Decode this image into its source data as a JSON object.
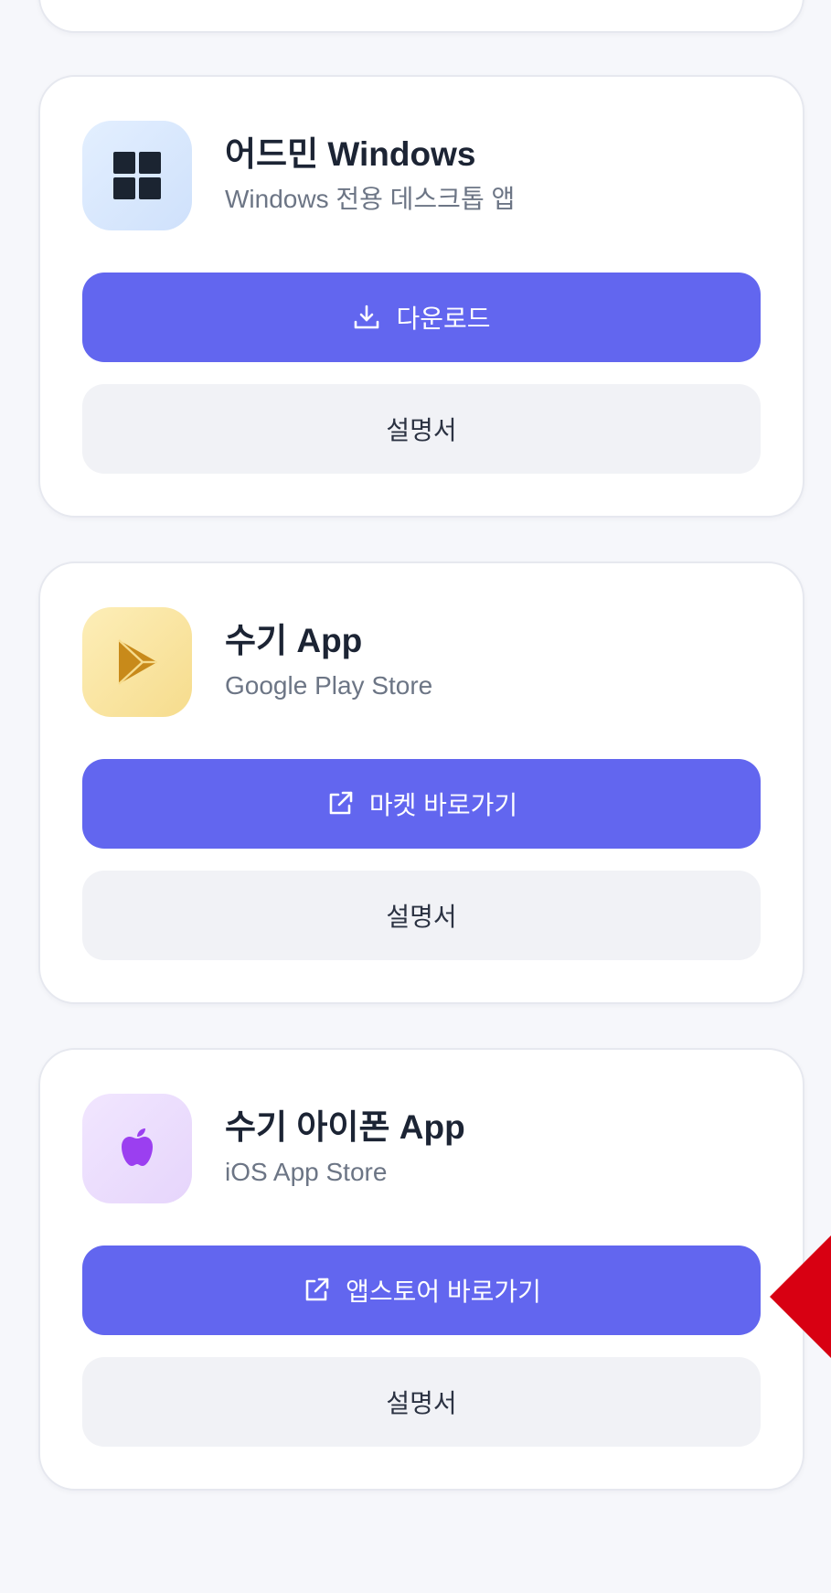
{
  "cards": [
    {
      "title": "어드민 Windows",
      "subtitle": "Windows 전용 데스크톱 앱",
      "icon": "windows-icon",
      "primary_label": "다운로드",
      "primary_icon": "download-icon",
      "secondary_label": "설명서"
    },
    {
      "title": "수기 App",
      "subtitle": "Google Play Store",
      "icon": "play-store-icon",
      "primary_label": "마켓 바로가기",
      "primary_icon": "external-link-icon",
      "secondary_label": "설명서"
    },
    {
      "title": "수기 아이폰 App",
      "subtitle": "iOS App Store",
      "icon": "apple-icon",
      "primary_label": "앱스토어 바로가기",
      "primary_icon": "external-link-icon",
      "secondary_label": "설명서"
    }
  ],
  "colors": {
    "primary_button": "#6266ef",
    "secondary_button": "#f1f2f6",
    "annotation_arrow": "#d80012"
  }
}
